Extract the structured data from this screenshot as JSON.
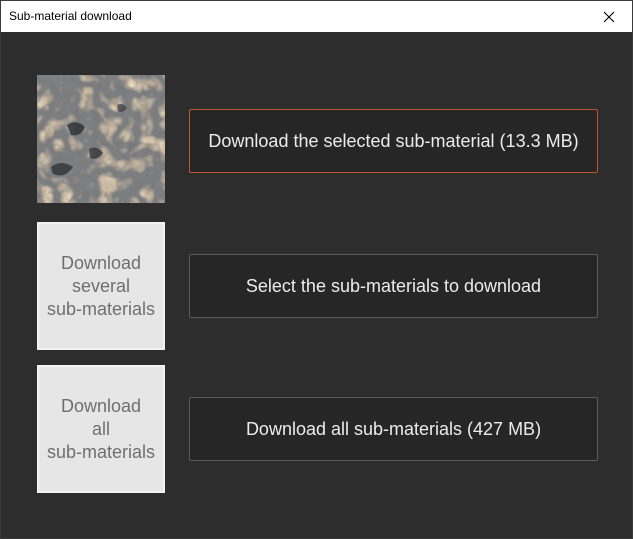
{
  "window": {
    "title": "Sub-material download"
  },
  "icons": {
    "close": "close-icon"
  },
  "thumbnails": {
    "several_text": "Download\nseveral\nsub-materials",
    "all_text": "Download\nall\nsub-materials"
  },
  "actions": {
    "download_selected": "Download the selected sub-material (13.3 MB)",
    "select_to_download": "Select the sub-materials to download",
    "download_all": "Download all sub-materials (427 MB)"
  },
  "colors": {
    "background": "#2d2d2d",
    "button_bg": "#262626",
    "button_border": "#5a5a5a",
    "accent_border": "#c0562f",
    "tile_bg": "#e6e6e6"
  }
}
